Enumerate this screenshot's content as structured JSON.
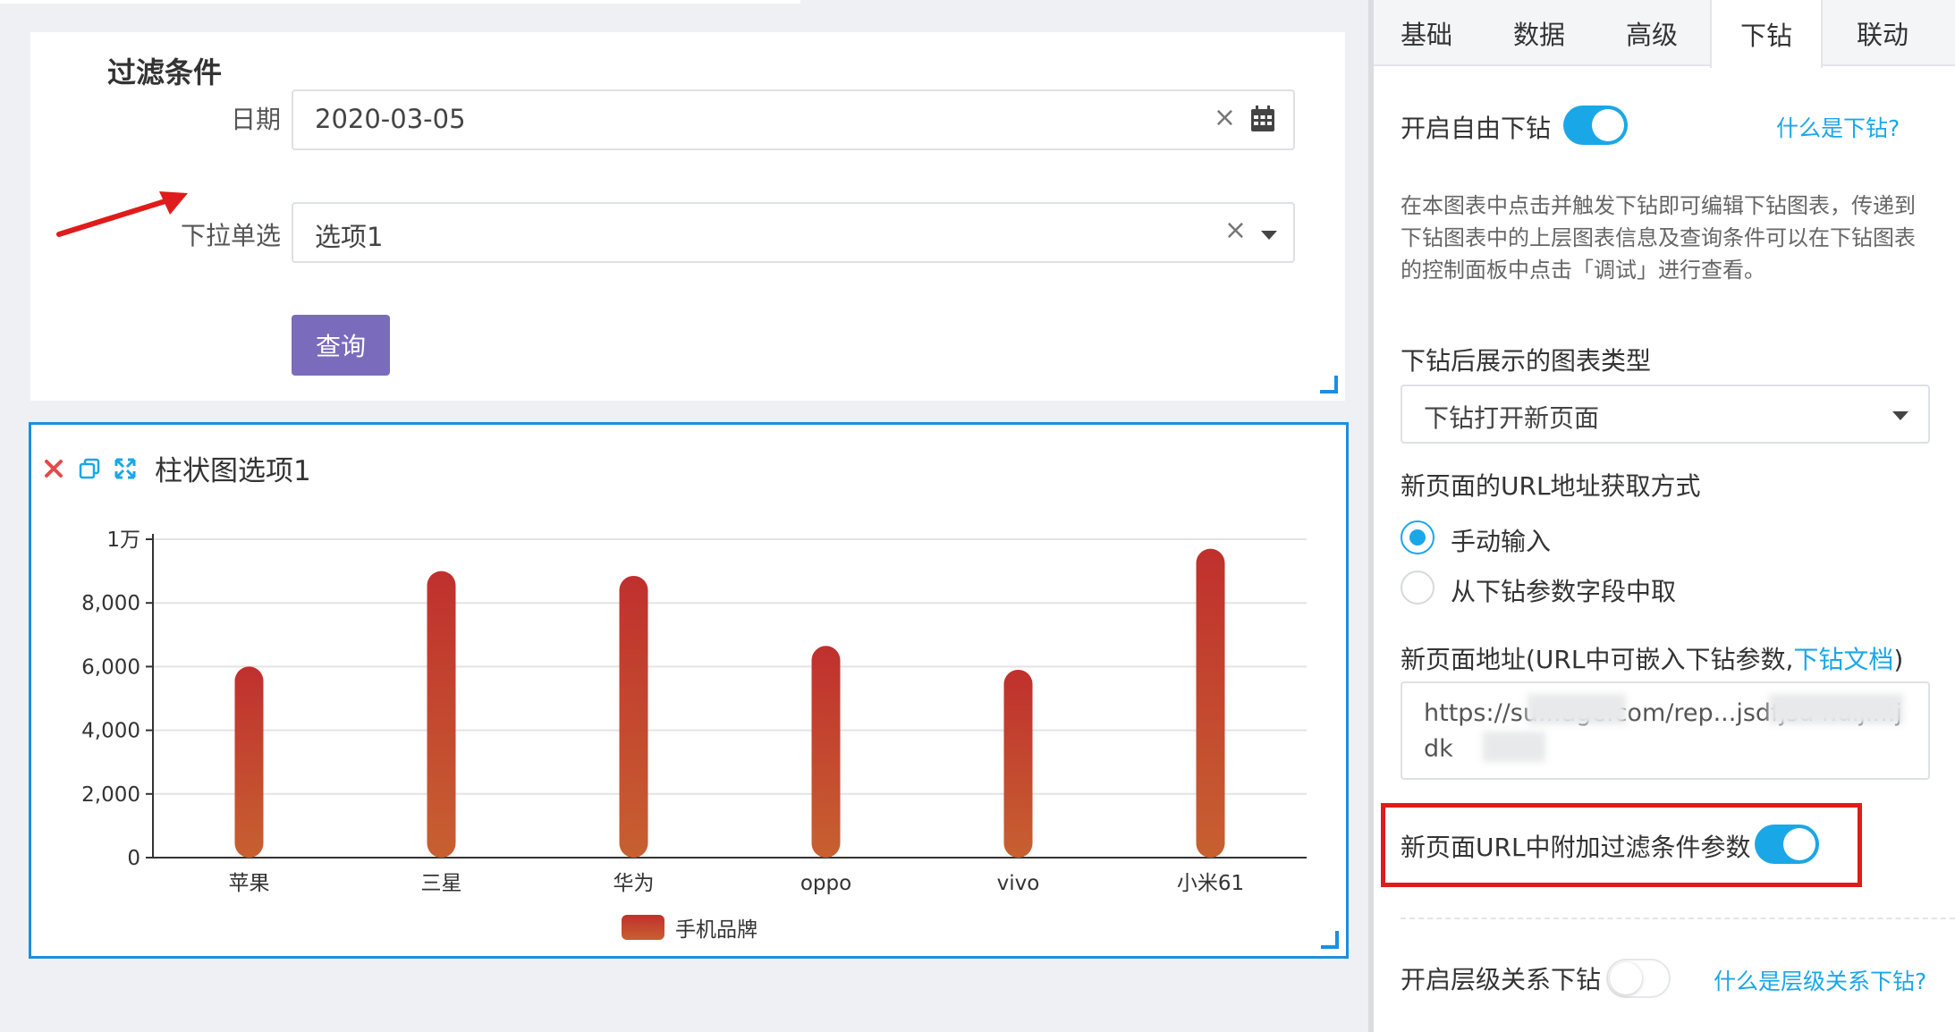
{
  "filter": {
    "title": "过滤条件",
    "date_label": "日期",
    "date_value": "2020-03-05",
    "select_label": "下拉单选",
    "select_value": "选项1",
    "clear_symbol": "×",
    "query_label": "查询"
  },
  "chart_panel": {
    "title": "柱状图选项1"
  },
  "chart_data": {
    "type": "bar",
    "categories": [
      "苹果",
      "三星",
      "华为",
      "oppo",
      "vivo",
      "小米61"
    ],
    "series": [
      {
        "name": "手机品牌",
        "values": [
          6000,
          9000,
          8850,
          6650,
          5900,
          9700
        ]
      }
    ],
    "ylim": [
      0,
      10000
    ],
    "yticks": [
      "0",
      "2,000",
      "4,000",
      "6,000",
      "8,000",
      "1万"
    ],
    "grid": true,
    "legend_position": "bottom",
    "colors": {
      "top": "#c0302e",
      "bottom": "#c76030"
    }
  },
  "tabs": [
    {
      "label": "基础"
    },
    {
      "label": "数据"
    },
    {
      "label": "高级"
    },
    {
      "label": "下钻"
    },
    {
      "label": "联动"
    }
  ],
  "drill": {
    "free_drill_label": "开启自由下钻",
    "free_drill_on": true,
    "what_is_drill": "什么是下钻?",
    "description": "在本图表中点击并触发下钻即可编辑下钻图表，传递到下钻图表中的上层图表信息及查询条件可以在下钻图表的控制面板中点击「调试」进行查看。",
    "chart_type_label": "下钻后展示的图表类型",
    "chart_type_value": "下钻打开新页面",
    "url_method_label": "新页面的URL地址获取方式",
    "radio_manual": "手动输入",
    "radio_field": "从下钻参数字段中取",
    "url_label_prefix": "新页面地址(URL中可嵌入下钻参数,",
    "url_doc_link": "下钻文档",
    "url_label_suffix": ")",
    "url_value": "https://su...age.com/rep...jsdfjsd hdljl...jdk",
    "append_filter_label": "新页面URL中附加过滤条件参数",
    "append_filter_on": true,
    "hierarchy_label": "开启层级关系下钻",
    "hierarchy_on": false,
    "what_is_hierarchy": "什么是层级关系下钻?"
  },
  "colors": {
    "accent": "#1aa7e8",
    "query_button": "#7b6bbd",
    "highlight_red": "#e01b1b"
  }
}
